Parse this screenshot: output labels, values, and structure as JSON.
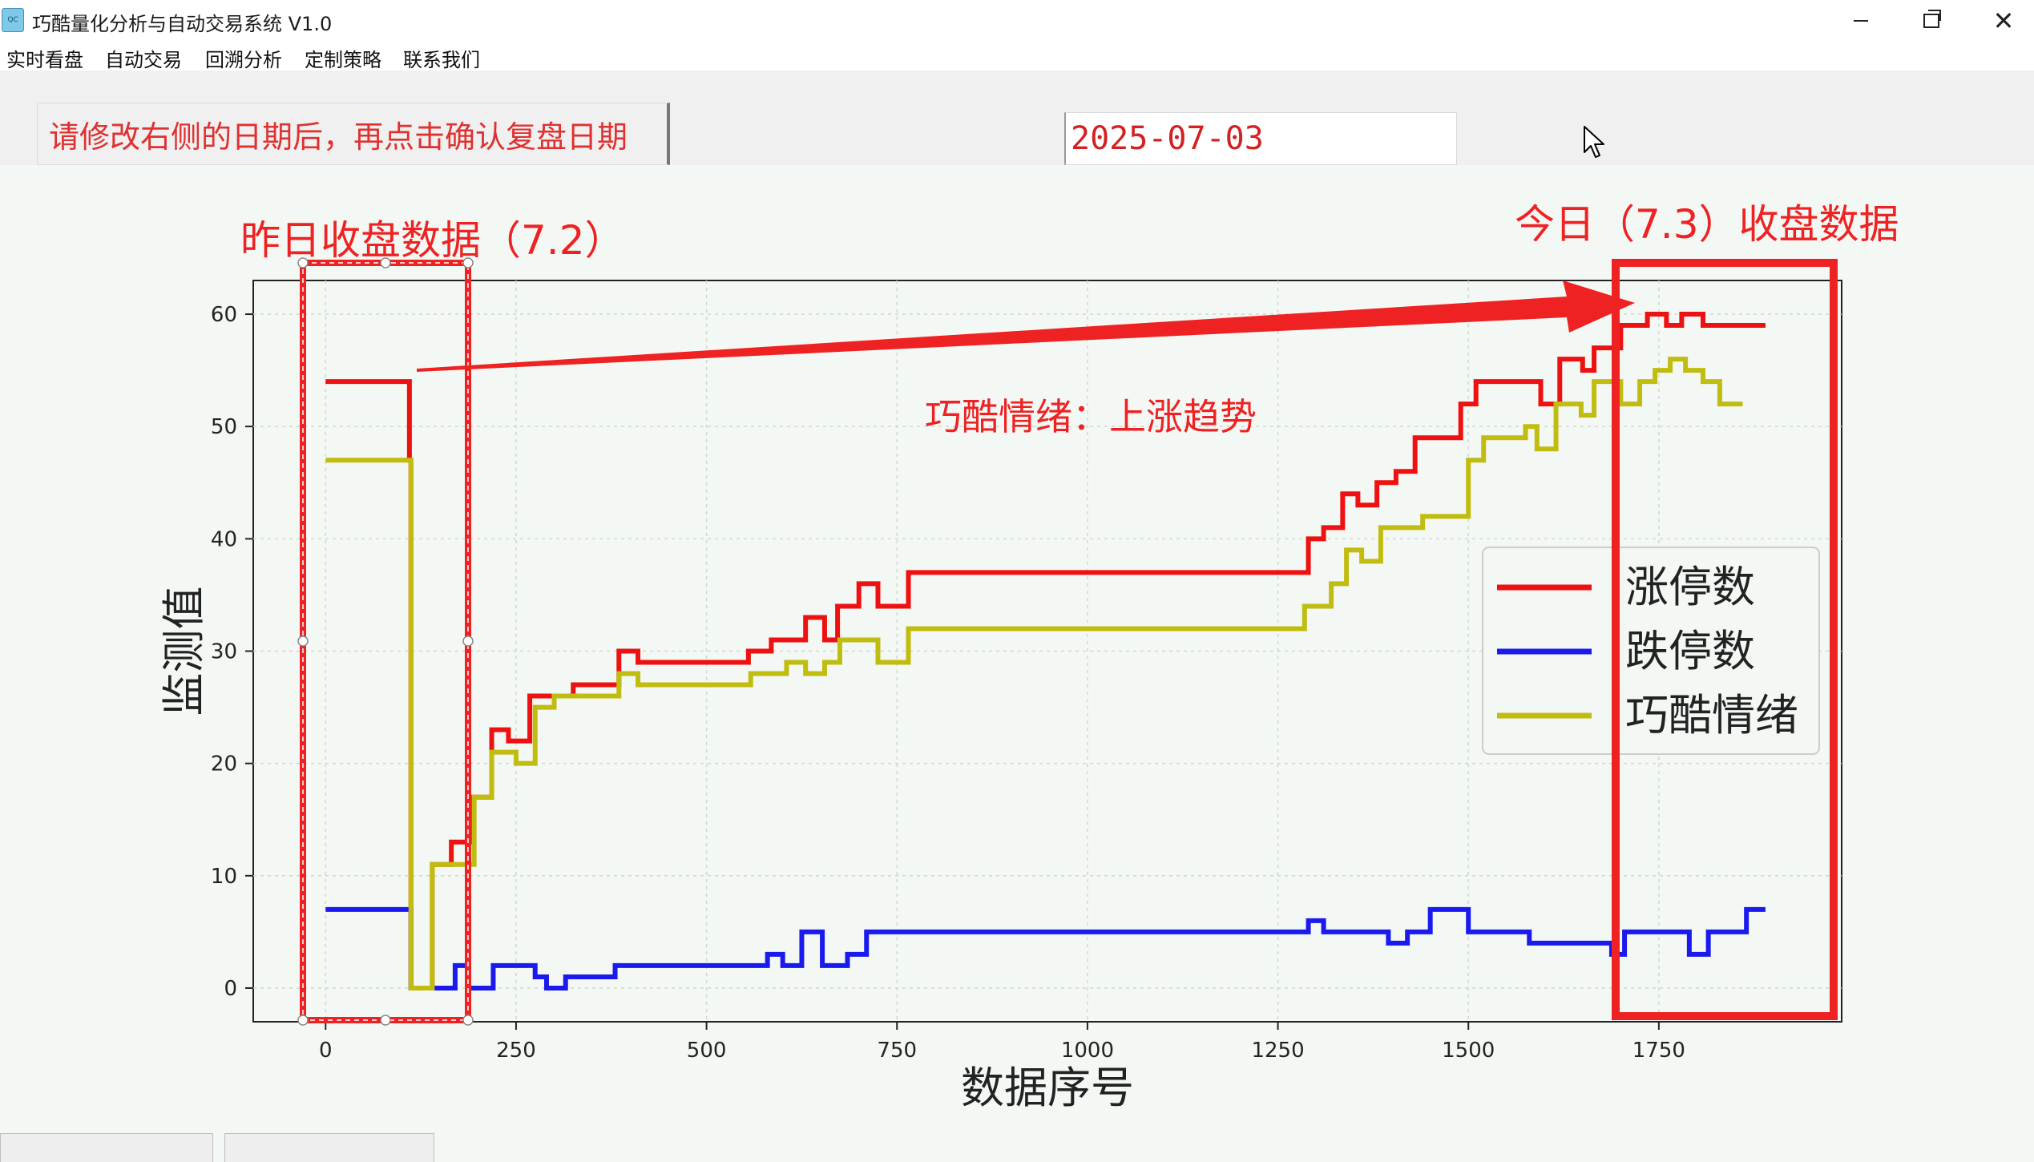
{
  "window": {
    "title": "巧酷量化分析与自动交易系统 V1.0",
    "icon": "app-logo-icon",
    "controls": [
      "minimize-icon",
      "restore-icon",
      "close-icon"
    ],
    "close_glyph": "✕"
  },
  "menu": {
    "items": [
      "实时看盘",
      "自动交易",
      "回溯分析",
      "定制策略",
      "联系我们"
    ]
  },
  "controls": {
    "instruction_button_label": "请修改右侧的日期后，再点击确认复盘日期",
    "date_value": "2025-07-03"
  },
  "annotations": {
    "yesterday_label": "昨日收盘数据（7.2）",
    "today_label": "今日（7.3）收盘数据",
    "sentiment_label": "巧酷情绪：上涨趋势",
    "color": "#ee2222"
  },
  "chart_data": {
    "type": "line",
    "step": true,
    "xlabel": "数据序号",
    "ylabel": "监测值",
    "xlim": [
      -95,
      1990
    ],
    "ylim": [
      -3,
      63
    ],
    "xticks": [
      0,
      250,
      500,
      750,
      1000,
      1250,
      1500,
      1750
    ],
    "yticks": [
      0,
      10,
      20,
      30,
      40,
      50,
      60
    ],
    "grid": true,
    "legend_position": "center-right",
    "series": [
      {
        "name": "涨停数",
        "color": "#ee1111",
        "points": [
          [
            0,
            54
          ],
          [
            110,
            47
          ],
          [
            112,
            0
          ],
          [
            140,
            11
          ],
          [
            160,
            11
          ],
          [
            165,
            13
          ],
          [
            185,
            13
          ],
          [
            190,
            17
          ],
          [
            210,
            17
          ],
          [
            218,
            23
          ],
          [
            240,
            22
          ],
          [
            255,
            22
          ],
          [
            268,
            26
          ],
          [
            290,
            26
          ],
          [
            320,
            26
          ],
          [
            325,
            27
          ],
          [
            375,
            27
          ],
          [
            385,
            30
          ],
          [
            405,
            30
          ],
          [
            410,
            29
          ],
          [
            550,
            29
          ],
          [
            555,
            30
          ],
          [
            580,
            30
          ],
          [
            585,
            31
          ],
          [
            620,
            31
          ],
          [
            630,
            33
          ],
          [
            650,
            33
          ],
          [
            655,
            31
          ],
          [
            672,
            34
          ],
          [
            700,
            36
          ],
          [
            725,
            34
          ],
          [
            765,
            37
          ],
          [
            1285,
            37
          ],
          [
            1290,
            40
          ],
          [
            1310,
            41
          ],
          [
            1335,
            44
          ],
          [
            1355,
            43
          ],
          [
            1380,
            45
          ],
          [
            1405,
            46
          ],
          [
            1430,
            49
          ],
          [
            1470,
            49
          ],
          [
            1490,
            52
          ],
          [
            1510,
            54
          ],
          [
            1580,
            54
          ],
          [
            1595,
            52
          ],
          [
            1620,
            56
          ],
          [
            1650,
            55
          ],
          [
            1665,
            57
          ],
          [
            1700,
            59
          ],
          [
            1735,
            60
          ],
          [
            1760,
            59
          ],
          [
            1780,
            60
          ],
          [
            1808,
            59
          ],
          [
            1840,
            59
          ],
          [
            1890,
            59
          ]
        ]
      },
      {
        "name": "跌停数",
        "color": "#1a1aee",
        "points": [
          [
            0,
            7
          ],
          [
            110,
            7
          ],
          [
            112,
            0
          ],
          [
            165,
            0
          ],
          [
            170,
            2
          ],
          [
            180,
            2
          ],
          [
            188,
            0
          ],
          [
            205,
            0
          ],
          [
            220,
            2
          ],
          [
            270,
            2
          ],
          [
            275,
            1
          ],
          [
            290,
            0
          ],
          [
            315,
            1
          ],
          [
            355,
            1
          ],
          [
            380,
            2
          ],
          [
            570,
            2
          ],
          [
            580,
            3
          ],
          [
            600,
            2
          ],
          [
            625,
            5
          ],
          [
            650,
            5
          ],
          [
            652,
            2
          ],
          [
            680,
            2
          ],
          [
            685,
            3
          ],
          [
            705,
            3
          ],
          [
            710,
            5
          ],
          [
            1280,
            5
          ],
          [
            1290,
            6
          ],
          [
            1310,
            5
          ],
          [
            1390,
            5
          ],
          [
            1395,
            4
          ],
          [
            1420,
            5
          ],
          [
            1450,
            7
          ],
          [
            1495,
            7
          ],
          [
            1500,
            5
          ],
          [
            1575,
            5
          ],
          [
            1580,
            4
          ],
          [
            1680,
            4
          ],
          [
            1688,
            3
          ],
          [
            1700,
            3
          ],
          [
            1705,
            5
          ],
          [
            1785,
            5
          ],
          [
            1790,
            3
          ],
          [
            1810,
            3
          ],
          [
            1815,
            5
          ],
          [
            1860,
            5
          ],
          [
            1865,
            7
          ],
          [
            1890,
            7
          ]
        ]
      },
      {
        "name": "巧酷情绪",
        "color": "#c0bc10",
        "points": [
          [
            0,
            47
          ],
          [
            110,
            47
          ],
          [
            112,
            0
          ],
          [
            138,
            0
          ],
          [
            140,
            11
          ],
          [
            190,
            11
          ],
          [
            195,
            17
          ],
          [
            212,
            17
          ],
          [
            218,
            21
          ],
          [
            240,
            21
          ],
          [
            250,
            20
          ],
          [
            270,
            20
          ],
          [
            275,
            25
          ],
          [
            290,
            25
          ],
          [
            300,
            26
          ],
          [
            375,
            26
          ],
          [
            385,
            28
          ],
          [
            405,
            28
          ],
          [
            410,
            27
          ],
          [
            550,
            27
          ],
          [
            558,
            28
          ],
          [
            600,
            28
          ],
          [
            605,
            29
          ],
          [
            625,
            29
          ],
          [
            630,
            28
          ],
          [
            655,
            29
          ],
          [
            675,
            31
          ],
          [
            720,
            31
          ],
          [
            725,
            29
          ],
          [
            745,
            29
          ],
          [
            765,
            32
          ],
          [
            1280,
            32
          ],
          [
            1285,
            34
          ],
          [
            1305,
            34
          ],
          [
            1320,
            36
          ],
          [
            1340,
            39
          ],
          [
            1360,
            38
          ],
          [
            1385,
            41
          ],
          [
            1430,
            41
          ],
          [
            1440,
            42
          ],
          [
            1490,
            42
          ],
          [
            1500,
            47
          ],
          [
            1520,
            49
          ],
          [
            1570,
            49
          ],
          [
            1575,
            50
          ],
          [
            1590,
            48
          ],
          [
            1615,
            52
          ],
          [
            1630,
            52
          ],
          [
            1648,
            51
          ],
          [
            1665,
            54
          ],
          [
            1700,
            52
          ],
          [
            1725,
            54
          ],
          [
            1745,
            55
          ],
          [
            1765,
            56
          ],
          [
            1785,
            55
          ],
          [
            1808,
            54
          ],
          [
            1830,
            52
          ],
          [
            1860,
            52
          ]
        ]
      }
    ]
  },
  "bottom_tabs": [
    "",
    ""
  ],
  "icons": {
    "cursor": "mouse-pointer-icon"
  }
}
